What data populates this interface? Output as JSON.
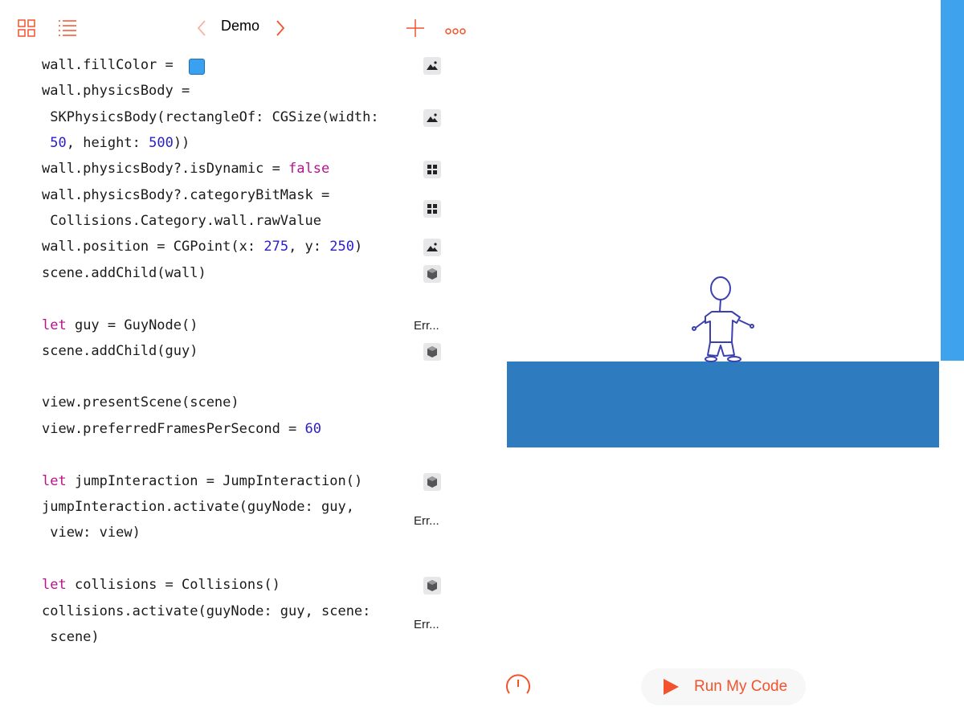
{
  "toolbar": {
    "title": "Demo",
    "accent": "#f2532c",
    "icons": [
      "grid-icon",
      "list-icon",
      "chevron-left-icon",
      "chevron-right-icon",
      "plus-icon",
      "more-icon"
    ]
  },
  "code": {
    "lines": [
      {
        "id": "l1",
        "parts": [
          {
            "t": "wall.fillColor = "
          }
        ]
      },
      {
        "id": "l2",
        "parts": [
          {
            "t": "wall.physicsBody ="
          }
        ]
      },
      {
        "id": "l3",
        "parts": [
          {
            "t": " SKPhysicsBody(rectangleOf: CGSize(width:"
          }
        ]
      },
      {
        "id": "l4",
        "parts": [
          {
            "t": " "
          },
          {
            "t": "50",
            "c": "num"
          },
          {
            "t": ", height: "
          },
          {
            "t": "500",
            "c": "num"
          },
          {
            "t": "))"
          }
        ]
      },
      {
        "id": "l5",
        "parts": [
          {
            "t": "wall.physicsBody?.isDynamic = "
          },
          {
            "t": "false",
            "c": "kw"
          }
        ]
      },
      {
        "id": "l6",
        "parts": [
          {
            "t": "wall.physicsBody?.categoryBitMask ="
          }
        ]
      },
      {
        "id": "l7",
        "parts": [
          {
            "t": " Collisions.Category.wall.rawValue"
          }
        ]
      },
      {
        "id": "l8",
        "parts": [
          {
            "t": "wall.position = CGPoint(x: "
          },
          {
            "t": "275",
            "c": "num"
          },
          {
            "t": ", y: "
          },
          {
            "t": "250",
            "c": "num"
          },
          {
            "t": ")"
          }
        ]
      },
      {
        "id": "l9",
        "parts": [
          {
            "t": "scene.addChild(wall)"
          }
        ]
      },
      {
        "id": "l10",
        "parts": [
          {
            "t": "let",
            "c": "kw"
          },
          {
            "t": " guy = GuyNode()"
          }
        ]
      },
      {
        "id": "l11",
        "parts": [
          {
            "t": "scene.addChild(guy)"
          }
        ]
      },
      {
        "id": "l12",
        "parts": [
          {
            "t": "view.presentScene(scene)"
          }
        ]
      },
      {
        "id": "l13",
        "parts": [
          {
            "t": "view.preferredFramesPerSecond = "
          },
          {
            "t": "60",
            "c": "num"
          }
        ]
      },
      {
        "id": "l14",
        "parts": [
          {
            "t": "let",
            "c": "kw"
          },
          {
            "t": " jumpInteraction = JumpInteraction()"
          }
        ]
      },
      {
        "id": "l15",
        "parts": [
          {
            "t": "jumpInteraction.activate(guyNode: guy,"
          }
        ]
      },
      {
        "id": "l16",
        "parts": [
          {
            "t": " view: view)"
          }
        ]
      },
      {
        "id": "l17",
        "parts": [
          {
            "t": "let",
            "c": "kw"
          },
          {
            "t": " collisions = Collisions()"
          }
        ]
      },
      {
        "id": "l18",
        "parts": [
          {
            "t": "collisions.activate(guyNode: guy, scene:"
          }
        ]
      },
      {
        "id": "l19",
        "parts": [
          {
            "t": " scene)"
          }
        ]
      }
    ],
    "fill_color_swatch": "#3aa0f0",
    "results": {
      "err_label": "Err...",
      "gutter_icons": [
        "image-icon",
        "image-icon",
        "grid-icon",
        "grid-icon",
        "image-icon",
        "cube-icon",
        "cube-icon",
        "cube-icon",
        "cube-icon"
      ]
    }
  },
  "live_view": {
    "platform_color": "#2f7bbf",
    "wall_color": "#3ea2ec",
    "character": "stick-figure"
  },
  "footer": {
    "run_label": "Run My Code",
    "speed_icon": "speedometer-icon",
    "run_icon": "play-icon"
  }
}
